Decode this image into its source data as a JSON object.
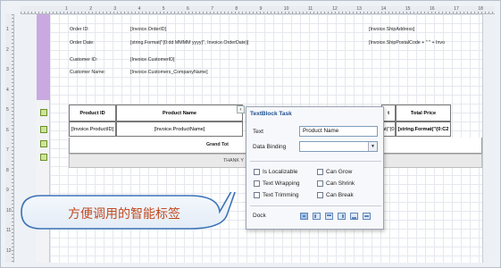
{
  "ruler": {
    "h_numbers": [
      "1",
      "2",
      "3",
      "4",
      "5",
      "6",
      "7",
      "8",
      "9",
      "10",
      "11",
      "12",
      "13",
      "14",
      "15",
      "16",
      "17",
      "18",
      "19"
    ],
    "v_numbers": [
      "1",
      "2",
      "3",
      "4",
      "5",
      "6",
      "7",
      "8",
      "9",
      "10",
      "11",
      "12"
    ]
  },
  "header_fields": {
    "order_id_label": "Order ID:",
    "order_id_value": "[Invoice.OrderID]",
    "order_date_label": "Order Date:",
    "order_date_value": "[string.Format(\"{0:dd MMMM yyyy}\", Invoice.OrderDate)]",
    "customer_id_label": "Customer ID:",
    "customer_id_value": "[Invoice.CustomerID]",
    "customer_name_label": "Customer Name:",
    "customer_name_value": "[Invoice.Customers_CompanyName]",
    "ship_address": "[Invoice.ShipAddress]",
    "ship_postal": "[Invoice.ShipPostalCode + \" \" + Invo"
  },
  "table": {
    "headers": [
      "Product ID",
      "Product Name",
      "t",
      "Total Price"
    ],
    "row": [
      "[Invoice.ProductID]",
      "[Invoice.ProductName]",
      "at(\"{0:C2}\",",
      "[string.Format(\"{0:C2"
    ],
    "grand_total": "Grand Tot",
    "thank_you": "THANK Y"
  },
  "popup": {
    "title": "TextBlock Task",
    "text_label": "Text",
    "text_value": "Product Name",
    "binding_label": "Data Binding",
    "binding_value": "",
    "checks": {
      "localizable": "Is Localizable",
      "can_grow": "Can Grow",
      "wrapping": "Text Wrapping",
      "can_shrink": "Can Shrink",
      "trimming": "Text Trimming",
      "can_break": "Can Break"
    },
    "dock_label": "Dock"
  },
  "callout": {
    "text": "方便调用的智能标签"
  },
  "colors": {
    "accent_title": "#1f4f8f",
    "callout_text": "#c24a1f",
    "band_purple": "#c9a9e0"
  }
}
